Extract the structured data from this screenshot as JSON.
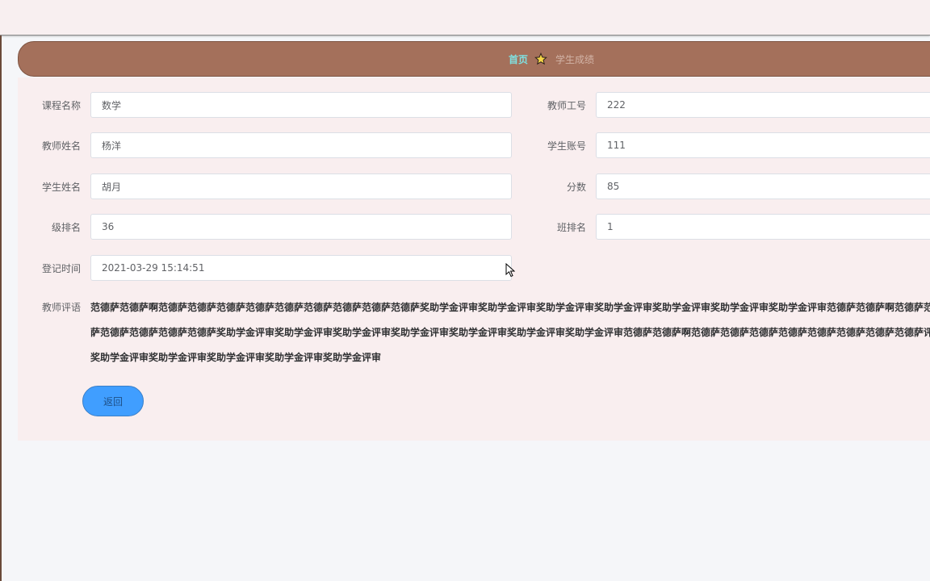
{
  "breadcrumb": {
    "home": "首页",
    "separator_icon": "star-icon",
    "current": "学生成绩"
  },
  "form": {
    "course_name": {
      "label": "课程名称",
      "value": "数学"
    },
    "teacher_id": {
      "label": "教师工号",
      "value": "222"
    },
    "teacher_name": {
      "label": "教师姓名",
      "value": "杨洋"
    },
    "student_account": {
      "label": "学生账号",
      "value": "111"
    },
    "student_name": {
      "label": "学生姓名",
      "value": "胡月"
    },
    "score": {
      "label": "分数",
      "value": "85"
    },
    "grade_rank": {
      "label": "级排名",
      "value": "36"
    },
    "class_rank": {
      "label": "班排名",
      "value": "1"
    },
    "register_time": {
      "label": "登记时间",
      "value": "2021-03-29 15:14:51"
    },
    "teacher_comment": {
      "label": "教师评语",
      "value": "范德萨范德萨啊范德萨范德萨范德萨范德萨范德萨范德萨范德萨范德萨范德萨奖助学金评审奖助学金评审奖助学金评审奖助学金评审奖助学金评审奖助学金评审奖助学金评审范德萨范德萨啊范德萨范德萨范德萨范德萨范德萨范德萨奖助学金评审奖助学金评审奖助学金评审奖助学金评审奖助学金评审奖助学金评审奖助学金评审范德萨范德萨啊范德萨范德萨范德萨范德萨范德萨范德萨范德萨范德萨评审奖助学金评审奖助学金评审奖助学金评审奖助学金评审奖助学金评审"
    }
  },
  "actions": {
    "back_label": "返回"
  },
  "colors": {
    "breadcrumb_bar": "#a4705b",
    "breadcrumb_home": "#7fe0e0",
    "button": "#409eff",
    "panel": "#f9eeef"
  }
}
